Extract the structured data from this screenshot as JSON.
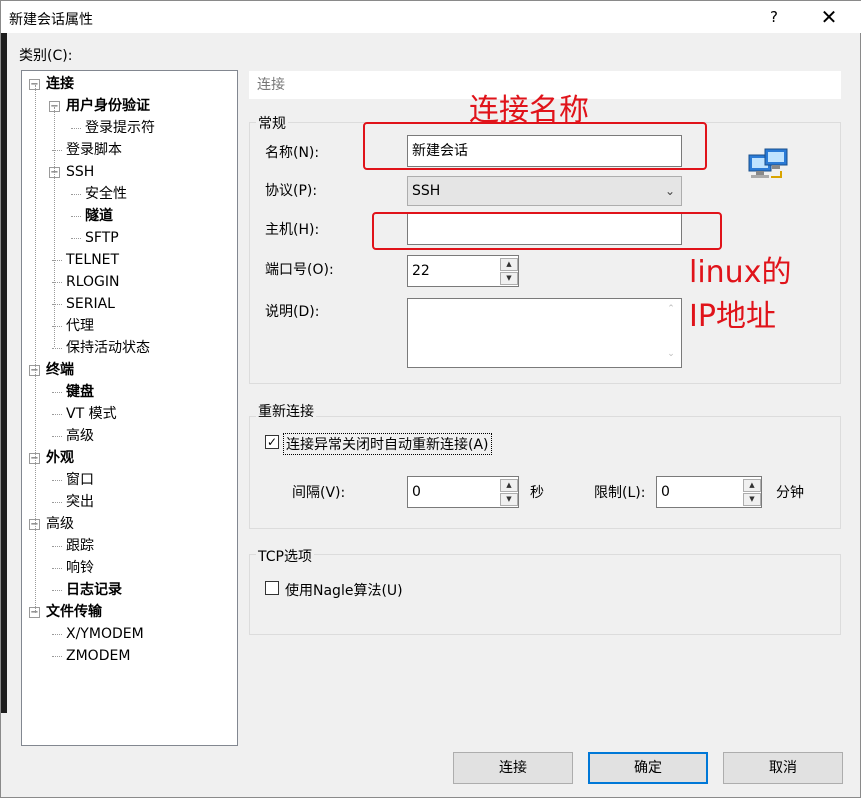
{
  "window": {
    "title": "新建会话属性",
    "help": "?",
    "close": "✕"
  },
  "category_label": "类别(C):",
  "tree": [
    {
      "label": "连接",
      "bold": true
    },
    {
      "label": "用户身份验证",
      "bold": true
    },
    {
      "label": "登录提示符",
      "bold": false
    },
    {
      "label": "登录脚本",
      "bold": false
    },
    {
      "label": "SSH",
      "bold": false
    },
    {
      "label": "安全性",
      "bold": false
    },
    {
      "label": "隧道",
      "bold": true
    },
    {
      "label": "SFTP",
      "bold": false
    },
    {
      "label": "TELNET",
      "bold": false
    },
    {
      "label": "RLOGIN",
      "bold": false
    },
    {
      "label": "SERIAL",
      "bold": false
    },
    {
      "label": "代理",
      "bold": false
    },
    {
      "label": "保持活动状态",
      "bold": false
    },
    {
      "label": "终端",
      "bold": true
    },
    {
      "label": "键盘",
      "bold": true
    },
    {
      "label": "VT 模式",
      "bold": false
    },
    {
      "label": "高级",
      "bold": false
    },
    {
      "label": "外观",
      "bold": true
    },
    {
      "label": "窗口",
      "bold": false
    },
    {
      "label": "突出",
      "bold": false
    },
    {
      "label": "高级",
      "bold": false
    },
    {
      "label": "跟踪",
      "bold": false
    },
    {
      "label": "响铃",
      "bold": false
    },
    {
      "label": "日志记录",
      "bold": true
    },
    {
      "label": "文件传输",
      "bold": true
    },
    {
      "label": "X/YMODEM",
      "bold": false
    },
    {
      "label": "ZMODEM",
      "bold": false
    }
  ],
  "header": "连接",
  "general": {
    "group": "常规",
    "name_label": "名称(N):",
    "name_value": "新建会话",
    "protocol_label": "协议(P):",
    "protocol_value": "SSH",
    "host_label": "主机(H):",
    "host_value": "",
    "port_label": "端口号(O):",
    "port_value": "22",
    "desc_label": "说明(D):",
    "desc_value": ""
  },
  "reconnect": {
    "group": "重新连接",
    "auto_label": "连接异常关闭时自动重新连接(A)",
    "auto_checked": true,
    "interval_label": "间隔(V):",
    "interval_value": "0",
    "interval_unit": "秒",
    "limit_label": "限制(L):",
    "limit_value": "0",
    "limit_unit": "分钟"
  },
  "tcp": {
    "group": "TCP选项",
    "nagle_label": "使用Nagle算法(U)",
    "nagle_checked": false
  },
  "buttons": {
    "connect": "连接",
    "ok": "确定",
    "cancel": "取消"
  },
  "annotations": {
    "name": "连接名称",
    "ip_line1": "linux的",
    "ip_line2": "IP地址"
  },
  "colors": {
    "annotation": "#e0131a",
    "default_button": "#0078d7"
  }
}
